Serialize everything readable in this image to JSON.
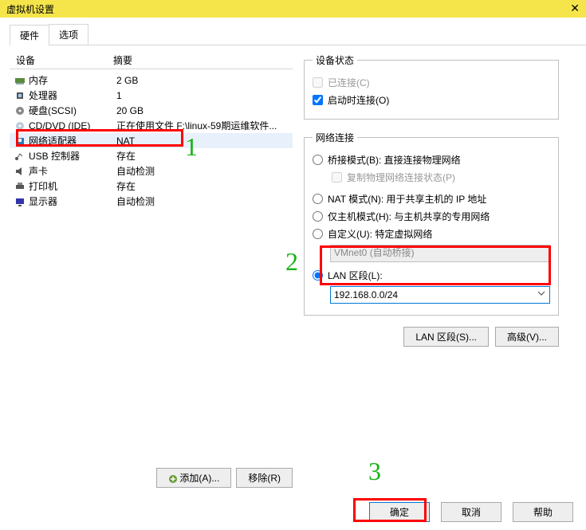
{
  "window": {
    "title": "虚拟机设置"
  },
  "tabs": {
    "hardware": "硬件",
    "options": "选项"
  },
  "list": {
    "hdr_device": "设备",
    "hdr_summary": "摘要",
    "rows": [
      {
        "icon": "memory-icon",
        "name": "内存",
        "summary": "2 GB"
      },
      {
        "icon": "cpu-icon",
        "name": "处理器",
        "summary": "1"
      },
      {
        "icon": "disk-icon",
        "name": "硬盘(SCSI)",
        "summary": "20 GB"
      },
      {
        "icon": "cd-icon",
        "name": "CD/DVD (IDE)",
        "summary": "正在使用文件 F:\\linux-59期运维软件..."
      },
      {
        "icon": "nic-icon",
        "name": "网络适配器",
        "summary": "NAT"
      },
      {
        "icon": "usb-icon",
        "name": "USB 控制器",
        "summary": "存在"
      },
      {
        "icon": "sound-icon",
        "name": "声卡",
        "summary": "自动检测"
      },
      {
        "icon": "printer-icon",
        "name": "打印机",
        "summary": "存在"
      },
      {
        "icon": "display-icon",
        "name": "显示器",
        "summary": "自动检测"
      }
    ],
    "add_btn": "添加(A)...",
    "remove_btn": "移除(R)"
  },
  "status": {
    "legend": "设备状态",
    "connected": "已连接(C)",
    "connect_at_poweron": "启动时连接(O)"
  },
  "net": {
    "legend": "网络连接",
    "bridged": "桥接模式(B): 直接连接物理网络",
    "replicate": "复制物理网络连接状态(P)",
    "nat": "NAT 模式(N): 用于共享主机的 IP 地址",
    "hostonly": "仅主机模式(H): 与主机共享的专用网络",
    "custom": "自定义(U): 特定虚拟网络",
    "vmnet0": "VMnet0 (自动桥接)",
    "lan": "LAN 区段(L):",
    "lan_value": "192.168.0.0/24",
    "lan_btn": "LAN 区段(S)...",
    "adv_btn": "高级(V)..."
  },
  "footer": {
    "ok": "确定",
    "cancel": "取消",
    "help": "帮助"
  },
  "anno": {
    "one": "1",
    "two": "2",
    "three": "3"
  },
  "colors": {
    "accent": "#0078d7",
    "annotation": "#18b318",
    "highlight": "#e8f0fb"
  }
}
